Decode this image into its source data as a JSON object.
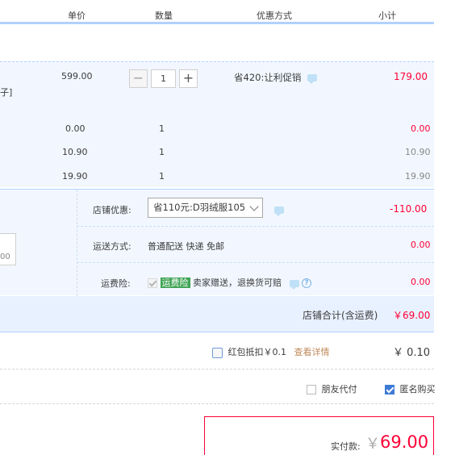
{
  "header": {
    "unit_price": "单价",
    "quantity": "数量",
    "discount_method": "优惠方式",
    "subtotal": "小计"
  },
  "item": {
    "left_fragment": "子]",
    "price": "599.00",
    "quantity": "1",
    "minus": "−",
    "plus": "+",
    "promo": "省420:让利促销",
    "subtotal": "179.00"
  },
  "extra_rows": [
    {
      "price": "0.00",
      "qty": "1",
      "subtotal": "0.00"
    },
    {
      "price": "10.90",
      "qty": "1",
      "subtotal": "10.90"
    },
    {
      "price": "19.90",
      "qty": "1",
      "subtotal": "19.90"
    }
  ],
  "shop": {
    "coupon_label": "店铺优惠:",
    "coupon_value": "省110元:D羽绒服105",
    "coupon_amount": "-110.00",
    "shipping_label": "运送方式:",
    "shipping_value": "普通配送 快递 免邮",
    "shipping_amount": "0.00",
    "insurance_label": "运费险:",
    "insurance_badge": "运费险",
    "insurance_text": "卖家赠送，退换货可赔",
    "insurance_amount": "0.00",
    "message_fragment": "00",
    "total_label": "店铺合计(含运费)",
    "total_value": "￥69.00"
  },
  "redpacket": {
    "label": "红包抵扣￥0.1",
    "link": "查看详情",
    "amount": "￥ 0.10"
  },
  "options": {
    "friend_pay": "朋友代付",
    "anonymous": "匿名购买"
  },
  "pay": {
    "label": "实付款:",
    "currency": "￥",
    "amount": "69.00"
  },
  "colors": {
    "accent": "#ff0036",
    "light_blue": "#f2f7ff",
    "border_blue": "#b2d1ff",
    "badge_green": "#3fa354"
  }
}
